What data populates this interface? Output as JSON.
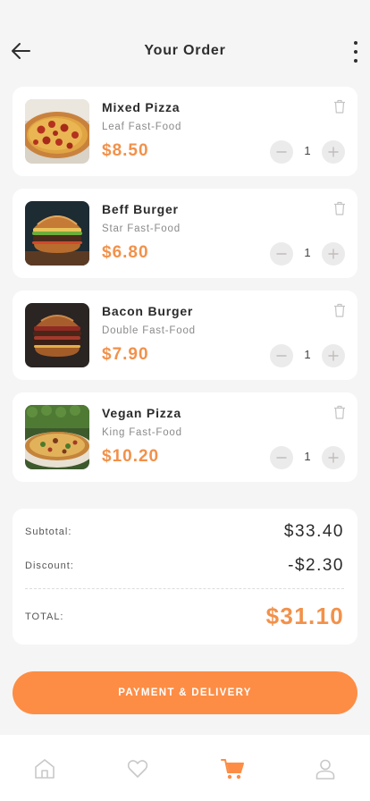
{
  "header": {
    "title": "Your Order"
  },
  "items": [
    {
      "name": "Mixed Pizza",
      "shop": "Leaf Fast-Food",
      "price": "$8.50",
      "quantity": "1",
      "image": "pizza-photo"
    },
    {
      "name": "Beff Burger",
      "shop": "Star Fast-Food",
      "price": "$6.80",
      "quantity": "1",
      "image": "burger-photo"
    },
    {
      "name": "Bacon Burger",
      "shop": "Double Fast-Food",
      "price": "$7.90",
      "quantity": "1",
      "image": "bacon-burger-photo"
    },
    {
      "name": "Vegan Pizza",
      "shop": "King Fast-Food",
      "price": "$10.20",
      "quantity": "1",
      "image": "vegan-pizza-photo"
    }
  ],
  "summary": {
    "subtotal_label": "Subtotal:",
    "subtotal_value": "$33.40",
    "discount_label": "Discount:",
    "discount_value": "-$2.30",
    "total_label": "TOTAL:",
    "total_value": "$31.10"
  },
  "checkout": {
    "button_label": "PAYMENT & DELIVERY"
  },
  "tabbar": {
    "tabs": [
      {
        "icon": "home-icon",
        "active": false
      },
      {
        "icon": "heart-icon",
        "active": false
      },
      {
        "icon": "cart-icon",
        "active": true
      },
      {
        "icon": "user-icon",
        "active": false
      }
    ]
  },
  "colors": {
    "accent": "#fd8d45",
    "price": "#f2914a",
    "background": "#f5f5f5",
    "card": "#ffffff",
    "inactive_icon": "#c8c8c8"
  }
}
